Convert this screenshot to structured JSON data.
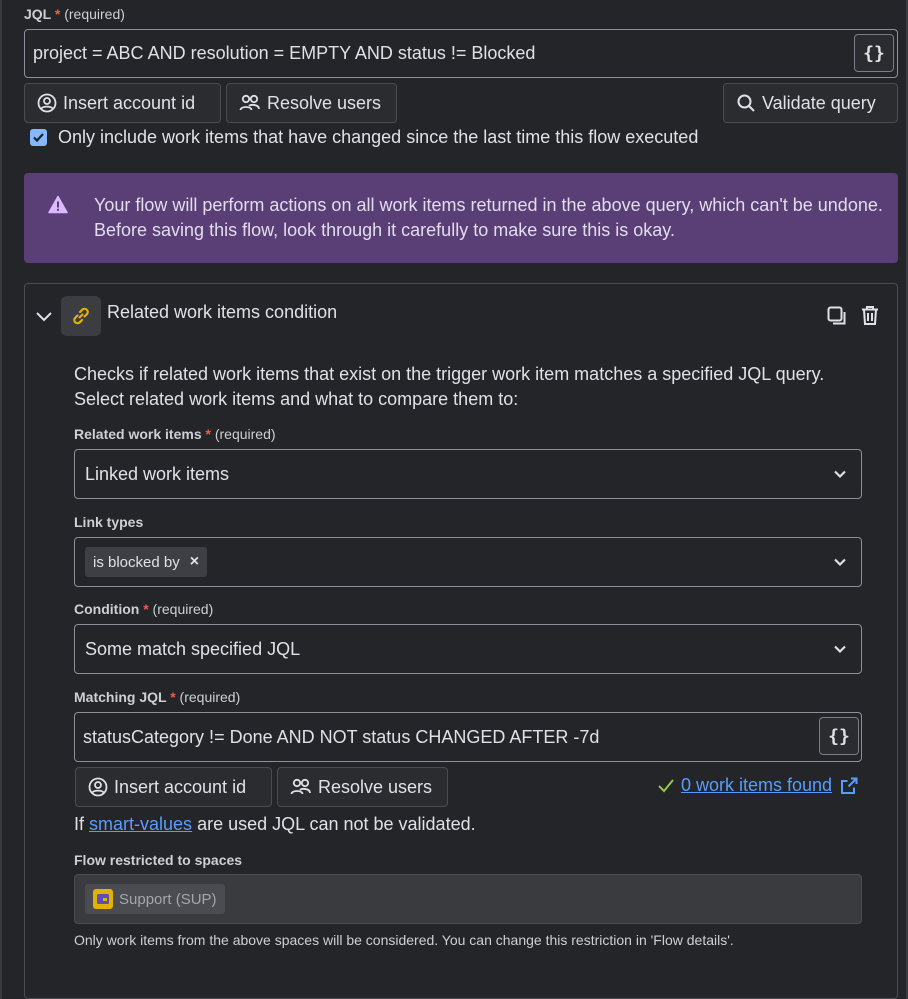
{
  "jql": {
    "label": "JQL",
    "required_mark": "*",
    "required_text": "(required)",
    "value": "project = ABC AND resolution = EMPTY AND status != Blocked",
    "braces": "{}"
  },
  "buttons": {
    "insert_account": "Insert account id",
    "resolve_users": "Resolve users",
    "validate": "Validate query"
  },
  "checkbox": {
    "checked": true,
    "label": "Only include work items that have changed since the last time this flow executed"
  },
  "warning": {
    "text": "Your flow will perform actions on all work items returned in the above query, which can't be undone. Before saving this flow, look through it carefully to make sure this is okay."
  },
  "condition": {
    "title": "Related work items condition",
    "description": "Checks if related work items that exist on the trigger work item matches a specified JQL query. Select related work items and what to compare them to:",
    "related": {
      "label": "Related work items",
      "required_mark": "*",
      "required_text": "(required)",
      "value": "Linked work items"
    },
    "link_types": {
      "label": "Link types",
      "tag": "is blocked by",
      "remove": "×"
    },
    "cond": {
      "label": "Condition",
      "required_mark": "*",
      "required_text": "(required)",
      "value": "Some match specified JQL"
    },
    "matching": {
      "label": "Matching JQL",
      "required_mark": "*",
      "required_text": "(required)",
      "value": "statusCategory != Done AND NOT status CHANGED AFTER -7d",
      "braces": "{}"
    },
    "insert_account": "Insert account id",
    "resolve_users": "Resolve users",
    "found": "0 work items found",
    "smart_prefix": "If",
    "smart_link": "smart-values",
    "smart_suffix": "are used JQL can not be validated.",
    "spaces": {
      "label": "Flow restricted to spaces",
      "value": "Support (SUP)",
      "note": "Only work items from the above spaces will be considered. You can change this restriction in 'Flow details'."
    }
  },
  "colors": {
    "accent": "#85b8ff",
    "link": "#579dff",
    "warning_bg": "#5a3f76",
    "success": "#94c748",
    "required": "#ef5c48"
  }
}
